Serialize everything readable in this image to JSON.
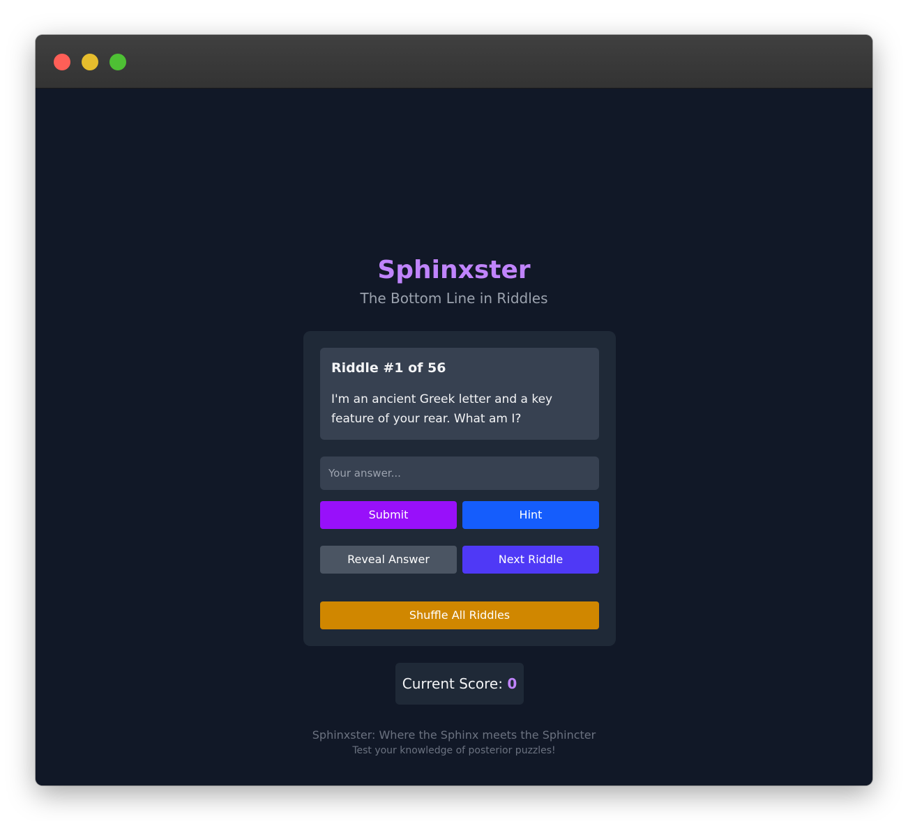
{
  "window": {
    "controls": [
      "close",
      "minimize",
      "maximize"
    ]
  },
  "header": {
    "title": "Sphinxster",
    "subtitle": "The Bottom Line in Riddles"
  },
  "riddle": {
    "heading": "Riddle #1 of 56",
    "text": "I'm an ancient Greek letter and a key feature of your rear. What am I?"
  },
  "answer": {
    "value": "",
    "placeholder": "Your answer..."
  },
  "buttons": {
    "submit": "Submit",
    "hint": "Hint",
    "reveal": "Reveal Answer",
    "next": "Next Riddle",
    "shuffle": "Shuffle All Riddles"
  },
  "score": {
    "label": "Current Score: ",
    "value": "0"
  },
  "footer": {
    "line1": "Sphinxster: Where the Sphinx meets the Sphincter",
    "line2": "Test your knowledge of posterior puzzles!"
  },
  "colors": {
    "background": "#111827",
    "card": "#1f2937",
    "accent": "#c084fc",
    "submit": "#9810fa",
    "hint": "#155dfc",
    "reveal": "#4b5563",
    "next": "#4f39f6",
    "shuffle": "#d08700"
  }
}
